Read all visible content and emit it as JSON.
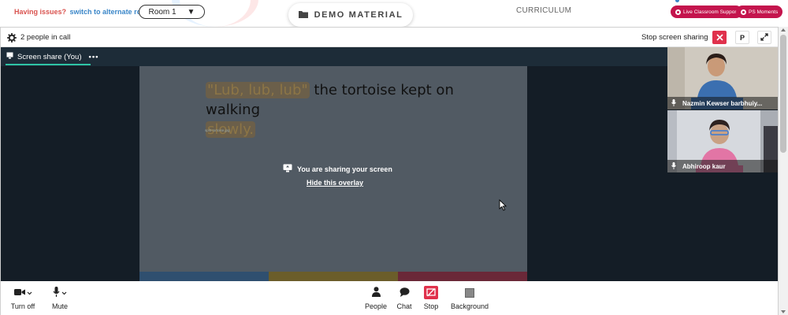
{
  "topbar": {
    "issues_text": "Having issues?",
    "alternate_link": "switch to alternate room",
    "room_value": "Room 1",
    "demo_tab_label": "DEMO MATERIAL",
    "curriculum_label": "CURRICULUM",
    "live_support_label": "Live Classroom Support",
    "ps_moments_label": "PS Moments"
  },
  "callbar": {
    "people_count": "2 people in call",
    "stop_sharing_label": "Stop screen sharing",
    "p_label": "P"
  },
  "share": {
    "tab_label": "Screen share (You)",
    "more_label": "•••",
    "slide_quote": "\"Lub, lub, lub\"",
    "slide_rest_1": " the tortoise kept on walking",
    "slide_line_2": "slowly.",
    "broken_image_alt": "split-tortoise.jpg",
    "overlay_message": "You are sharing your screen",
    "overlay_hide": "Hide this overlay"
  },
  "participants": [
    {
      "name": "Nazmin Kewser barbhuiy..."
    },
    {
      "name": "Abhiroop kaur"
    }
  ],
  "controls": {
    "turn_off": "Turn off",
    "mute": "Mute",
    "people": "People",
    "chat": "Chat",
    "stop": "Stop",
    "background": "Background"
  },
  "colors": {
    "accent_red": "#e0314c",
    "brand_pink": "#c4144d",
    "tab_underline": "#2ec4a5",
    "stage_bg": "#141d26"
  }
}
